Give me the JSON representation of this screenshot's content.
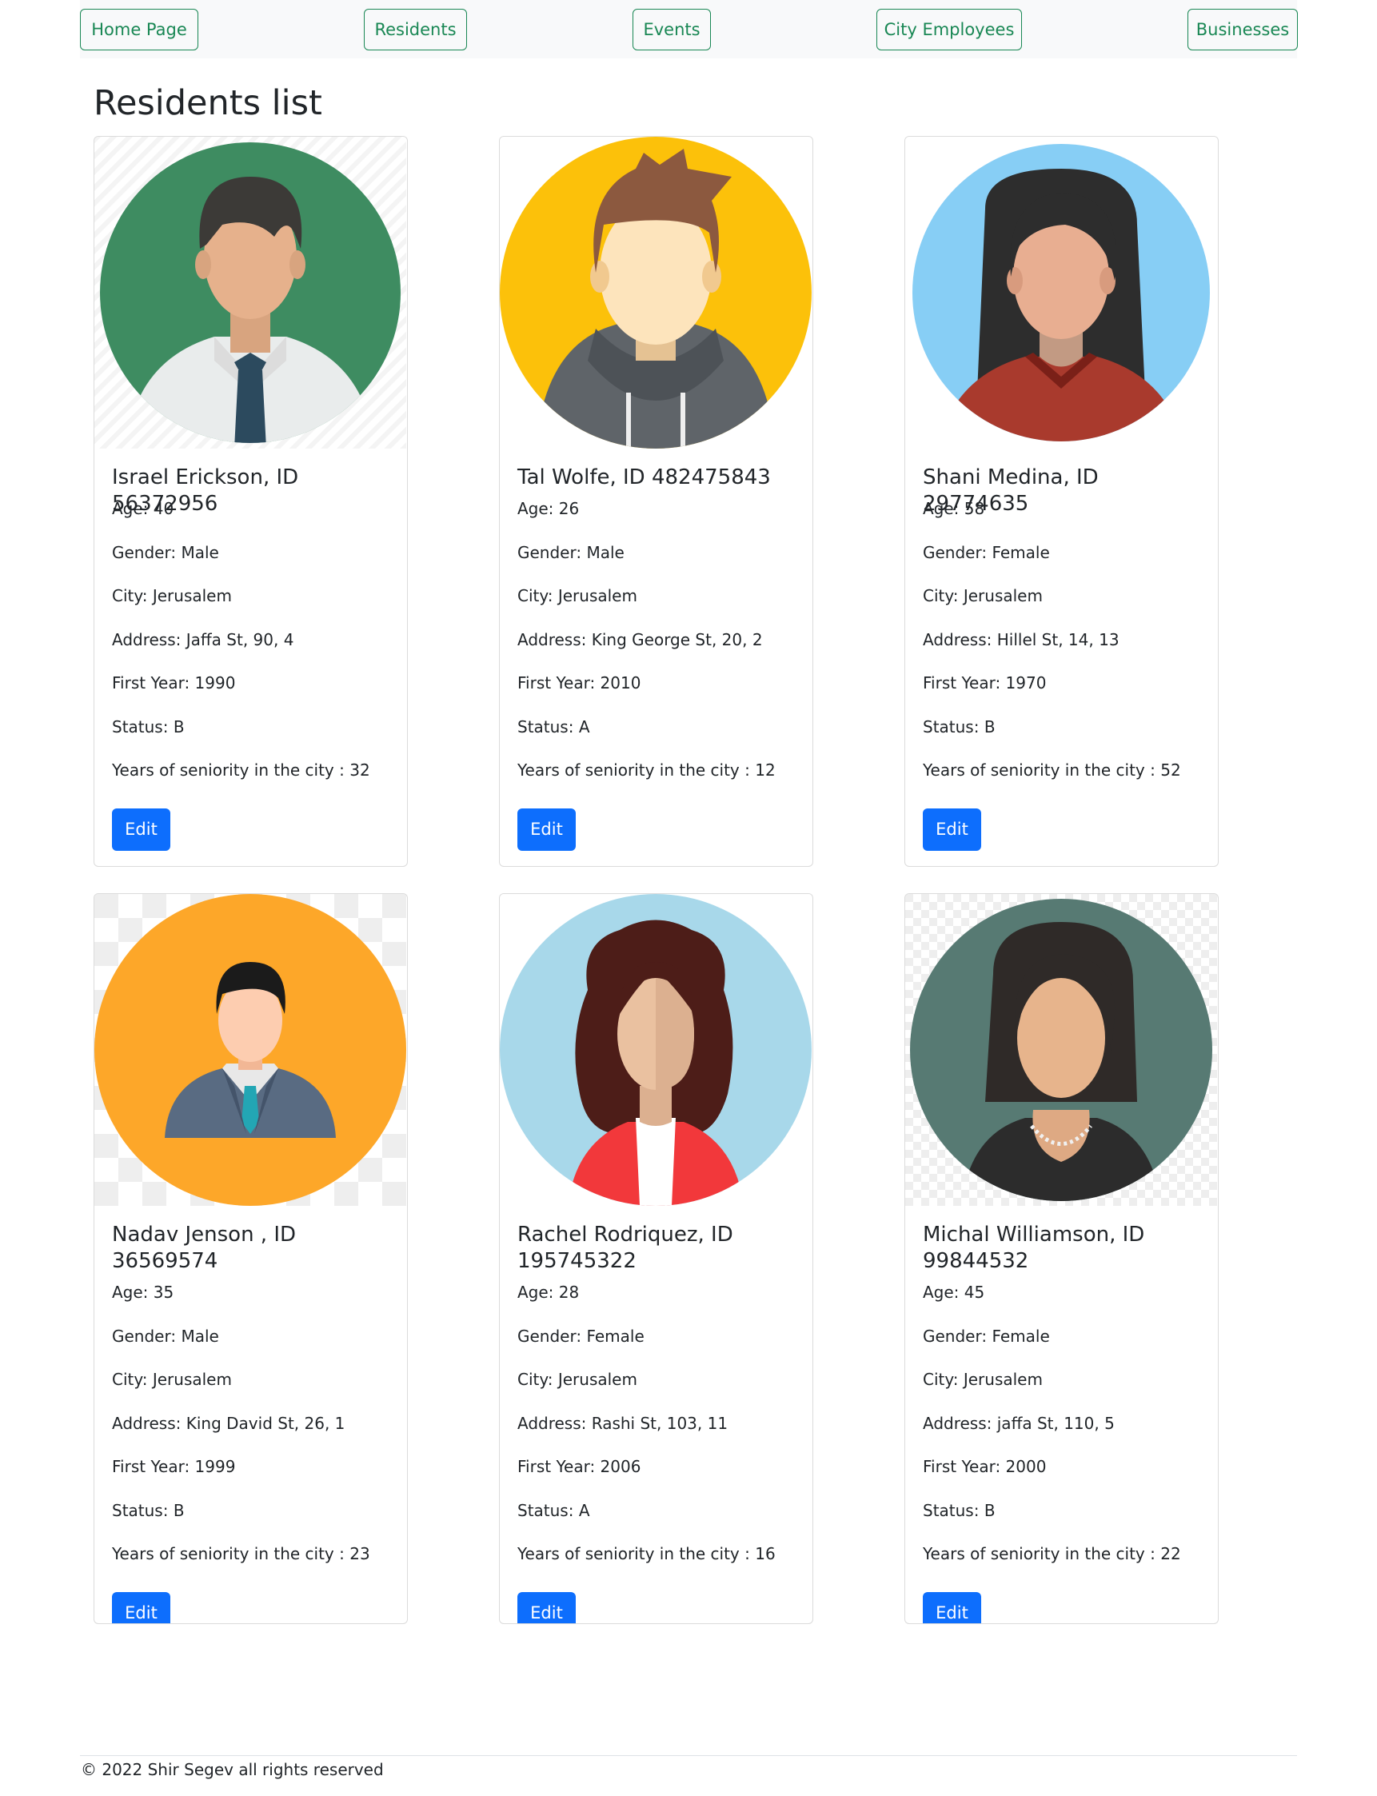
{
  "nav": {
    "items": [
      {
        "label": "Home Page"
      },
      {
        "label": "Residents"
      },
      {
        "label": "Events"
      },
      {
        "label": "City Employees"
      },
      {
        "label": "Businesses"
      }
    ]
  },
  "page_title": "Residents list",
  "card_labels": {
    "age": "Age:",
    "gender": "Gender:",
    "city": "City:",
    "address": "Address:",
    "first_year": "First Year:",
    "status": "Status:",
    "seniority": "Years of seniority in the city :",
    "edit": "Edit"
  },
  "residents": [
    {
      "title": "Israel Erickson, ID 56372956",
      "avatar": "man-with-tie-avatar",
      "avatar_bg": "#3e8c61",
      "age": "40",
      "gender": "Male",
      "city": "Jerusalem",
      "address": "Jaffa St, 90, 4",
      "first_year": "1990",
      "status": "B",
      "seniority": "32"
    },
    {
      "title": "Tal Wolfe, ID 482475843",
      "avatar": "man-in-hoodie-avatar",
      "avatar_bg": "#fcc10a",
      "age": "26",
      "gender": "Male",
      "city": "Jerusalem",
      "address": "King George St, 20, 2",
      "first_year": "2010",
      "status": "A",
      "seniority": "12"
    },
    {
      "title": "Shani Medina, ID 29774635",
      "avatar": "woman-long-hair-avatar",
      "avatar_bg": "#87cef5",
      "age": "58",
      "gender": "Female",
      "city": "Jerusalem",
      "address": "Hillel St, 14, 13",
      "first_year": "1970",
      "status": "B",
      "seniority": "52"
    },
    {
      "title": "Nadav Jenson , ID 36569574",
      "avatar": "businessman-avatar",
      "avatar_bg": "#fda729",
      "age": "35",
      "gender": "Male",
      "city": "Jerusalem",
      "address": "King David St, 26, 1",
      "first_year": "1999",
      "status": "B",
      "seniority": "23"
    },
    {
      "title": "Rachel Rodriquez, ID 195745322",
      "avatar": "woman-curly-hair-avatar",
      "avatar_bg": "#a8d8ea",
      "age": "28",
      "gender": "Female",
      "city": "Jerusalem",
      "address": "Rashi St, 103, 11",
      "first_year": "2006",
      "status": "A",
      "seniority": "16"
    },
    {
      "title": "Michal Williamson, ID 99844532",
      "avatar": "woman-pearl-necklace-avatar",
      "avatar_bg": "#577a73",
      "age": "45",
      "gender": "Female",
      "city": "Jerusalem",
      "address": "jaffa St, 110, 5",
      "first_year": "2000",
      "status": "B",
      "seniority": "22"
    }
  ],
  "footer": {
    "text": "© 2022 Shir Segev all rights reserved"
  },
  "colors": {
    "nav_outline": "#198754",
    "primary_button": "#0d6efd"
  }
}
